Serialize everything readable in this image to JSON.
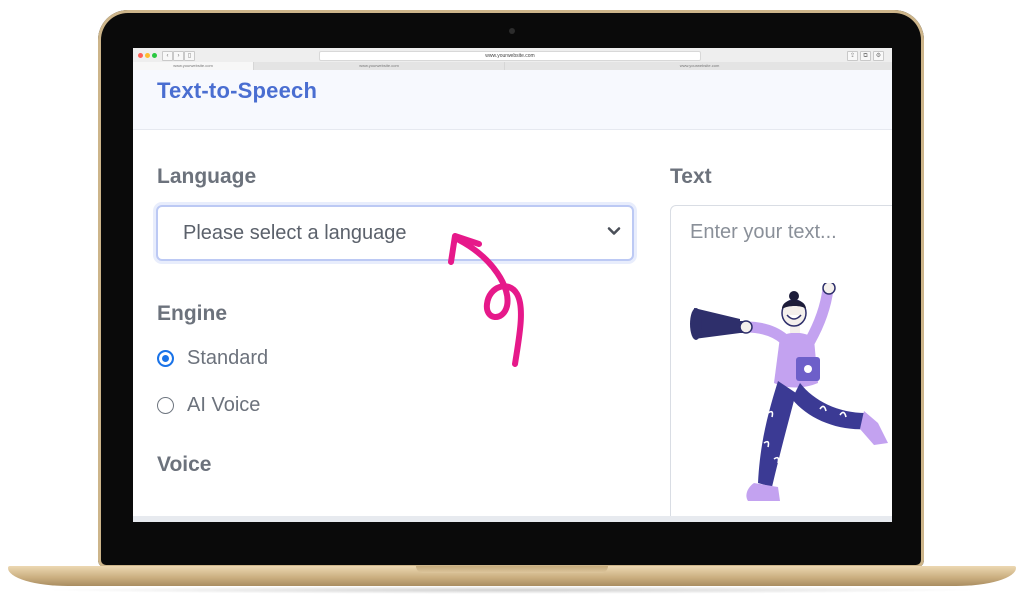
{
  "browser": {
    "url": "www.yourwebsite.com",
    "tabs": [
      "www.yourwebsite.com",
      "www.yourwebsite.com",
      "www.yourwebsite.com"
    ]
  },
  "app": {
    "title": "Text-to-Speech"
  },
  "form": {
    "language_label": "Language",
    "language_placeholder": "Please select a language",
    "text_label": "Text",
    "text_placeholder": "Enter your text...",
    "engine_label": "Engine",
    "engine_options": [
      {
        "label": "Standard",
        "selected": true
      },
      {
        "label": "AI Voice",
        "selected": false
      }
    ],
    "voice_label": "Voice"
  },
  "icons": {
    "dropdown": "chevron-down-icon",
    "annotation": "arrow-annotation-icon",
    "illustration": "person-megaphone-illustration"
  },
  "colors": {
    "accent": "#4a6ed1",
    "radio_selected": "#1a73e8",
    "annotation": "#e6198a",
    "laptop_frame": "#cdb58a"
  }
}
